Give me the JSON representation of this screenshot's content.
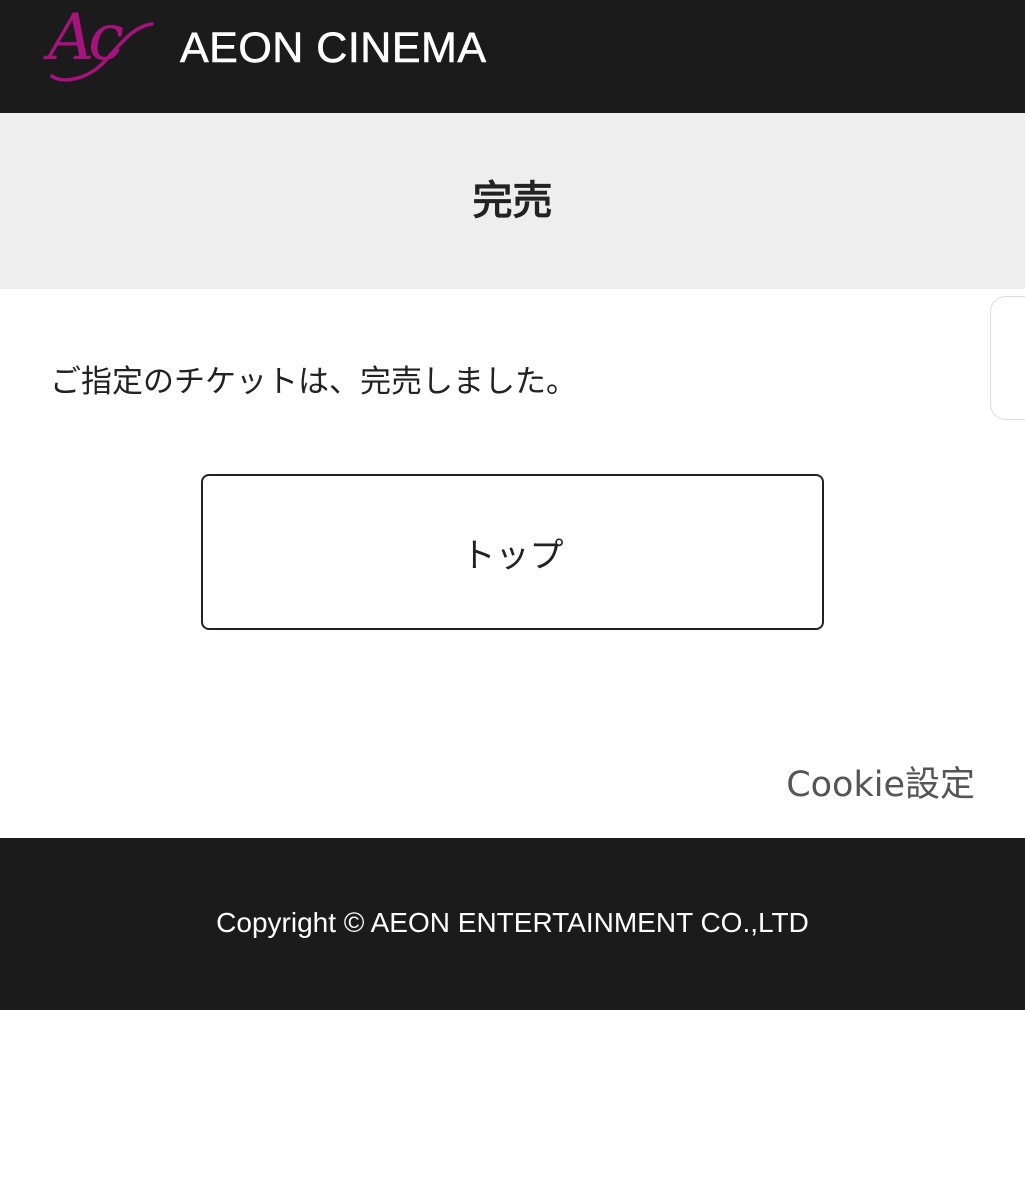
{
  "header": {
    "logo_mark": "Ac",
    "brand_name": "AEON CINEMA",
    "logo_color": "#a8127f",
    "background_color": "#1c1b1c"
  },
  "title_band": {
    "title": "完売",
    "background_color": "#eeeeee"
  },
  "main": {
    "message": "ご指定のチケットは、完売しました。",
    "top_button_label": "トップ",
    "cookie_link_label": "Cookie設定"
  },
  "footer": {
    "copyright": "Copyright © AEON ENTERTAINMENT CO.,LTD",
    "background_color": "#1c1b1c"
  }
}
